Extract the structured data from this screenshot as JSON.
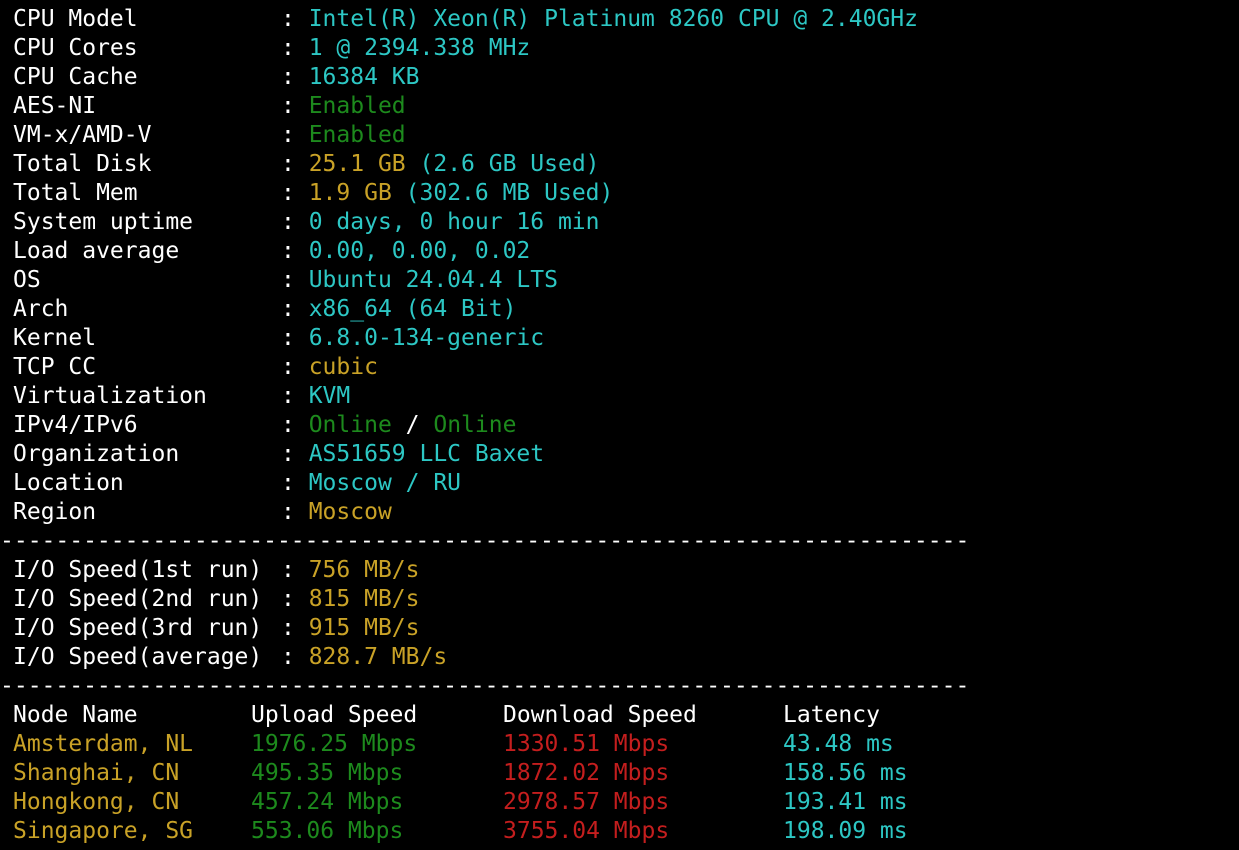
{
  "sysinfo": [
    {
      "label": "CPU Model",
      "sep": ": ",
      "value": "Intel(R) Xeon(R) Platinum 8260 CPU @ 2.40GHz",
      "color": "cyan"
    },
    {
      "label": "CPU Cores",
      "sep": ": ",
      "value": "1 @ 2394.338 MHz",
      "color": "cyan"
    },
    {
      "label": "CPU Cache",
      "sep": ": ",
      "value": "16384 KB",
      "color": "cyan"
    },
    {
      "label": "AES-NI",
      "sep": ": ",
      "value": "Enabled",
      "color": "green"
    },
    {
      "label": "VM-x/AMD-V",
      "sep": ": ",
      "value": "Enabled",
      "color": "green"
    },
    {
      "label": "Total Disk",
      "sep": ": ",
      "value": "25.1 GB",
      "value2": "(2.6 GB Used)",
      "color": "yellow",
      "color2": "cyan"
    },
    {
      "label": "Total Mem",
      "sep": ": ",
      "value": "1.9 GB",
      "value2": "(302.6 MB Used)",
      "color": "yellow",
      "color2": "cyan"
    },
    {
      "label": "System uptime",
      "sep": ": ",
      "value": "0 days, 0 hour 16 min",
      "color": "cyan"
    },
    {
      "label": "Load average",
      "sep": ": ",
      "value": "0.00, 0.00, 0.02",
      "color": "cyan"
    },
    {
      "label": "OS",
      "sep": ": ",
      "value": "Ubuntu 24.04.4 LTS",
      "color": "cyan"
    },
    {
      "label": "Arch",
      "sep": ": ",
      "value": "x86_64 (64 Bit)",
      "color": "cyan"
    },
    {
      "label": "Kernel",
      "sep": ": ",
      "value": "6.8.0-134-generic",
      "color": "cyan"
    },
    {
      "label": "TCP CC",
      "sep": ": ",
      "value": "cubic",
      "color": "yellow"
    },
    {
      "label": "Virtualization",
      "sep": ": ",
      "value": "KVM",
      "color": "cyan"
    },
    {
      "label": "Organization",
      "sep": ": ",
      "value": "AS51659 LLC Baxet",
      "color": "cyan"
    },
    {
      "label": "Location",
      "sep": ": ",
      "value": "Moscow / RU",
      "color": "cyan"
    },
    {
      "label": "Region",
      "sep": ": ",
      "value": "Moscow",
      "color": "yellow"
    }
  ],
  "ip": {
    "label": "IPv4/IPv6",
    "sep": ": ",
    "v4": "Online",
    "slash": " / ",
    "v6": "Online"
  },
  "divider": "----------------------------------------------------------------------",
  "io": [
    {
      "label": "I/O Speed(1st run)",
      "sep": ": ",
      "value": "756 MB/s"
    },
    {
      "label": "I/O Speed(2nd run)",
      "sep": ": ",
      "value": "815 MB/s"
    },
    {
      "label": "I/O Speed(3rd run)",
      "sep": ": ",
      "value": "915 MB/s"
    },
    {
      "label": "I/O Speed(average)",
      "sep": ": ",
      "value": "828.7 MB/s"
    }
  ],
  "speedtest": {
    "headers": {
      "node": "Node Name",
      "upload": "Upload Speed",
      "download": "Download Speed",
      "latency": "Latency"
    },
    "rows": [
      {
        "node": "Amsterdam, NL",
        "upload": "1976.25 Mbps",
        "download": "1330.51 Mbps",
        "latency": "43.48 ms"
      },
      {
        "node": "Shanghai, CN",
        "upload": "495.35 Mbps",
        "download": "1872.02 Mbps",
        "latency": "158.56 ms"
      },
      {
        "node": "Hongkong, CN",
        "upload": "457.24 Mbps",
        "download": "2978.57 Mbps",
        "latency": "193.41 ms"
      },
      {
        "node": "Singapore, SG",
        "upload": "553.06 Mbps",
        "download": "3755.04 Mbps",
        "latency": "198.09 ms"
      }
    ]
  },
  "colors": {
    "background": "#000000",
    "text": "#ffffff",
    "cyan": "#2dc7c4",
    "green": "#1d8a1d",
    "yellow": "#c9a227",
    "red": "#c41e1e"
  }
}
